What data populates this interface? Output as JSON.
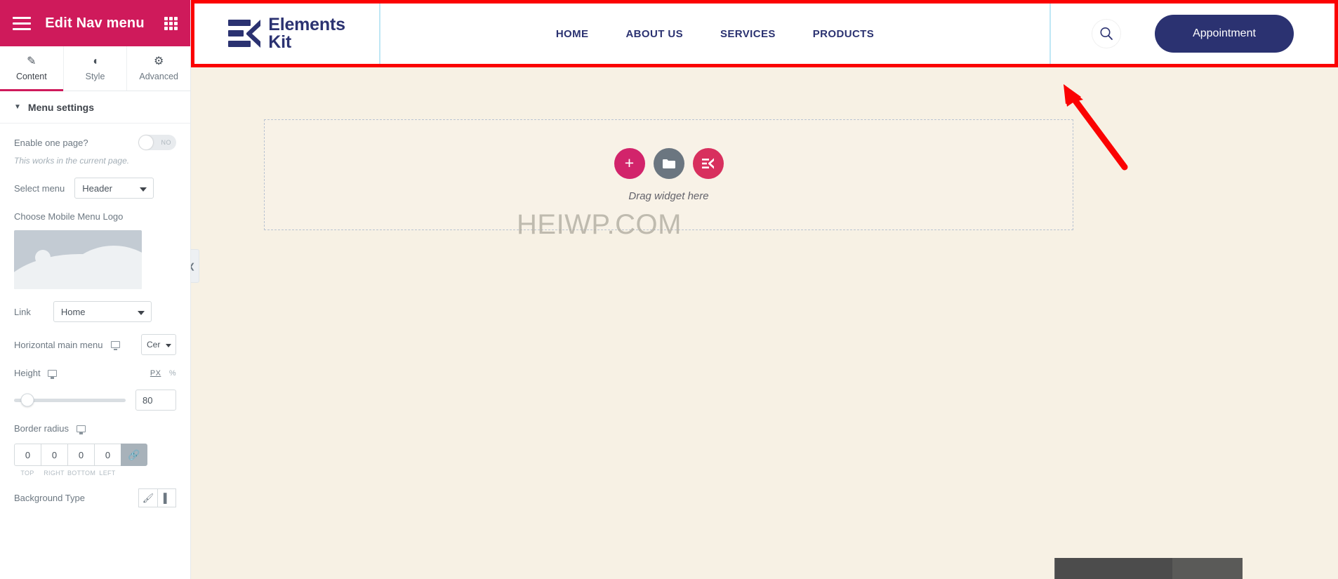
{
  "panel": {
    "title": "Edit Nav menu",
    "menu_icon": "hamburger-icon",
    "apps_icon": "grid-apps-icon",
    "tabs": [
      {
        "label": "Content",
        "icon": "pencil-icon",
        "active": true
      },
      {
        "label": "Style",
        "icon": "contrast-circle-icon",
        "active": false
      },
      {
        "label": "Advanced",
        "icon": "gear-icon",
        "active": false
      }
    ],
    "section": {
      "title": "Menu settings",
      "caret": "▼"
    },
    "controls": {
      "enable_one_page": {
        "label": "Enable one page?",
        "toggle_value": "NO",
        "hint": "This works in the current page."
      },
      "select_menu": {
        "label": "Select menu",
        "value": "Header"
      },
      "mobile_logo": {
        "label": "Choose Mobile Menu Logo"
      },
      "link": {
        "label": "Link",
        "value": "Home"
      },
      "horizontal_main_menu": {
        "label": "Horizontal main menu",
        "value": "Cer"
      },
      "height": {
        "label": "Height",
        "unit_px": "PX",
        "unit_pct": "%",
        "value": "80"
      },
      "border_radius": {
        "label": "Border radius",
        "values": [
          "0",
          "0",
          "0",
          "0"
        ],
        "sides": [
          "TOP",
          "RIGHT",
          "BOTTOM",
          "LEFT"
        ],
        "link_icon": "link-chain-icon"
      },
      "background_type": {
        "label": "Background Type",
        "classic_icon": "paint-brush-icon",
        "gradient_icon": "gradient-icon"
      }
    }
  },
  "header": {
    "logo": {
      "line1": "Elements",
      "line2": "Kit",
      "mark": "ek-logo-icon"
    },
    "nav": [
      {
        "label": "HOME"
      },
      {
        "label": "ABOUT US"
      },
      {
        "label": "SERVICES"
      },
      {
        "label": "PRODUCTS"
      }
    ],
    "search_icon": "search-icon",
    "appointment_button": "Appointment"
  },
  "canvas": {
    "dropzone": {
      "text": "Drag widget here",
      "add_icon": "plus-icon",
      "folder_icon": "folder-icon",
      "template_icon": "elementskit-icon"
    },
    "watermark": "HEIWP.COM",
    "collapse_icon": "chevron-left-icon",
    "annotation_arrow": "red-arrow-annotation"
  },
  "colors": {
    "panel_header": "#cf1a5b",
    "accent_pink": "#d2246b",
    "brand_navy": "#2b3271",
    "highlight_red": "#fb0202",
    "canvas_bg": "#f7f1e4"
  }
}
